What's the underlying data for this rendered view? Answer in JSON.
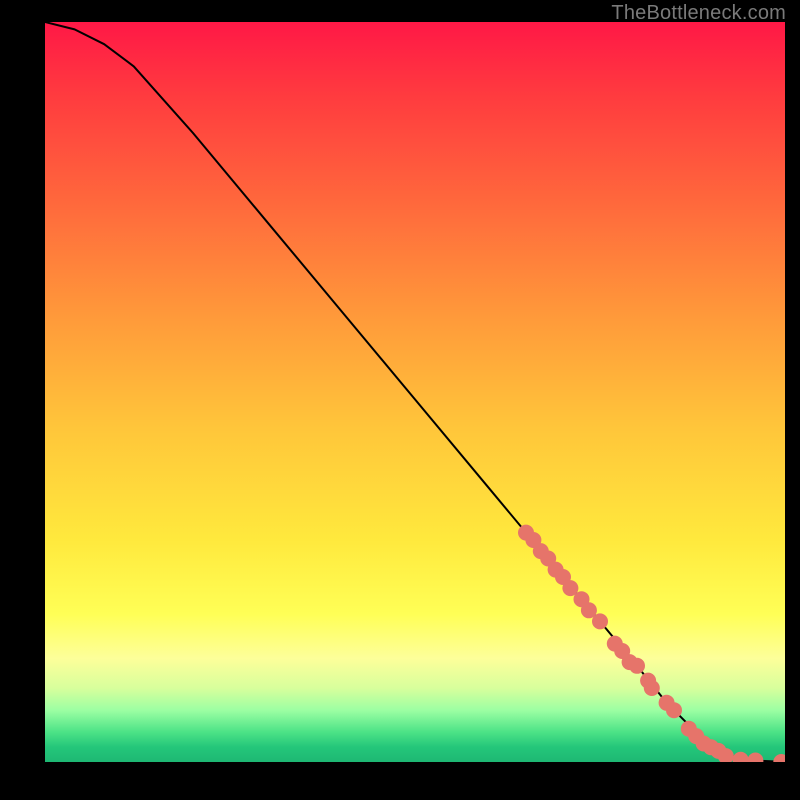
{
  "attribution": "TheBottleneck.com",
  "chart_data": {
    "type": "line",
    "title": "",
    "xlabel": "",
    "ylabel": "",
    "xlim": [
      0,
      100
    ],
    "ylim": [
      0,
      100
    ],
    "grid": false,
    "legend": false,
    "series": [
      {
        "name": "curve",
        "x": [
          0,
          4,
          8,
          12,
          20,
          30,
          40,
          50,
          60,
          70,
          75,
          80,
          84,
          86,
          88,
          90,
          92,
          94,
          96,
          98,
          100
        ],
        "y": [
          100,
          99,
          97,
          94,
          85,
          73,
          61,
          49,
          37,
          25,
          19,
          13,
          8,
          6,
          4,
          2,
          1,
          0.5,
          0.2,
          0.1,
          0
        ]
      }
    ],
    "markers": [
      {
        "x": 65,
        "y": 31
      },
      {
        "x": 66,
        "y": 30
      },
      {
        "x": 67,
        "y": 28.5
      },
      {
        "x": 68,
        "y": 27.5
      },
      {
        "x": 69,
        "y": 26
      },
      {
        "x": 70,
        "y": 25
      },
      {
        "x": 71,
        "y": 23.5
      },
      {
        "x": 72.5,
        "y": 22
      },
      {
        "x": 73.5,
        "y": 20.5
      },
      {
        "x": 75,
        "y": 19
      },
      {
        "x": 77,
        "y": 16
      },
      {
        "x": 78,
        "y": 15
      },
      {
        "x": 79,
        "y": 13.5
      },
      {
        "x": 80,
        "y": 13
      },
      {
        "x": 81.5,
        "y": 11
      },
      {
        "x": 82,
        "y": 10
      },
      {
        "x": 84,
        "y": 8
      },
      {
        "x": 85,
        "y": 7
      },
      {
        "x": 87,
        "y": 4.5
      },
      {
        "x": 88,
        "y": 3.5
      },
      {
        "x": 89,
        "y": 2.5
      },
      {
        "x": 90,
        "y": 2
      },
      {
        "x": 91,
        "y": 1.5
      },
      {
        "x": 92,
        "y": 0.8
      },
      {
        "x": 94,
        "y": 0.3
      },
      {
        "x": 96,
        "y": 0.2
      },
      {
        "x": 99.5,
        "y": 0
      }
    ],
    "style": {
      "line_color": "#000000",
      "marker_color": "#e6746a",
      "marker_radius_px": 8
    }
  }
}
